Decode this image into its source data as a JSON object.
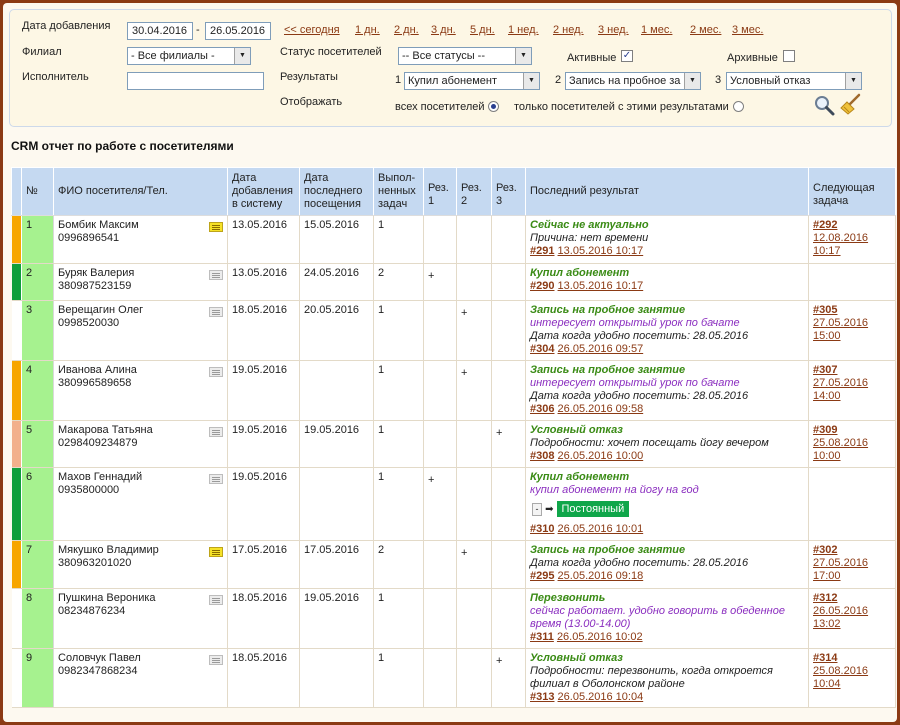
{
  "filters": {
    "date_label": "Дата добавления",
    "date_from": "30.04.2016",
    "dash": "-",
    "date_to": "26.05.2016",
    "quick_links": [
      "<< сегодня",
      "1 дн.",
      "2 дн.",
      "3 дн.",
      "5 дн.",
      "1 нед.",
      "2 нед.",
      "3 нед.",
      "1 мес.",
      "2 мес.",
      "3 мес."
    ],
    "branch_label": "Филиал",
    "branch_value": "- Все филиалы -",
    "status_label": "Статус посетителей",
    "status_value": "-- Все статусы --",
    "active_label": "Активные",
    "active_checked": true,
    "archive_label": "Архивные",
    "archive_checked": false,
    "executor_label": "Исполнитель",
    "executor_value": "",
    "results_label": "Результаты",
    "result1_num": "1",
    "result1_value": "Купил абонемент",
    "result2_num": "2",
    "result2_value": "Запись на пробное за",
    "result3_num": "3",
    "result3_value": "Условный отказ",
    "display_label": "Отображать",
    "display_all": "всех посетителей",
    "display_only": "только посетителей с этими результатами",
    "display_selected": "all"
  },
  "report": {
    "title": "CRM отчет по работе с посетителями",
    "headers": {
      "num": "№",
      "name": "ФИО посетителя/Тел.",
      "added": "Дата добавления в систему",
      "last_visit": "Дата последнего посещения",
      "done": "Выпол-ненных задач",
      "r1": "Рез. 1",
      "r2": "Рез. 2",
      "r3": "Рез. 3",
      "last_result": "Последний результат",
      "next_task": "Следующая задача"
    },
    "colors": {
      "orange": "#f7a600",
      "green": "#0f9e3c",
      "peach": "#f2b08c",
      "num_bg": "#a6f28f",
      "header_bg": "#c5d9f1"
    },
    "rows": [
      {
        "status": "orange",
        "num": "1",
        "name": "Бомбик Максим",
        "phone": "0996896541",
        "icon": "yellow",
        "added": "13.05.2016",
        "last_visit": "15.05.2016",
        "done": "1",
        "r1": "",
        "r2": "",
        "r3": "",
        "result": "Сейчас не актуально",
        "lines": [
          {
            "cls": "plain",
            "text": "Причина: нет времени"
          }
        ],
        "task_num": "#291",
        "task_date": "13.05.2016 10:17",
        "next_num": "#292",
        "next_date": "12.08.2016",
        "next_time": "10:17"
      },
      {
        "status": "green",
        "num": "2",
        "name": "Буряк Валерия",
        "phone": "380987523159",
        "icon": "grey",
        "added": "13.05.2016",
        "last_visit": "24.05.2016",
        "done": "2",
        "r1": "+",
        "r2": "",
        "r3": "",
        "result": "Купил абонемент",
        "lines": [],
        "task_num": "#290",
        "task_date": "13.05.2016 10:17",
        "next_num": "",
        "next_date": "",
        "next_time": ""
      },
      {
        "status": "none",
        "num": "3",
        "name": "Верещагин Олег",
        "phone": "0998520030",
        "icon": "grey",
        "added": "18.05.2016",
        "last_visit": "20.05.2016",
        "done": "1",
        "r1": "",
        "r2": "+",
        "r3": "",
        "result": "Запись на пробное занятие",
        "lines": [
          {
            "cls": "note",
            "text": "интересует открытый урок по бачате"
          },
          {
            "cls": "plain",
            "text": "Дата когда удобно посетить: 28.05.2016"
          }
        ],
        "task_num": "#304",
        "task_date": "26.05.2016 09:57",
        "next_num": "#305",
        "next_date": "27.05.2016",
        "next_time": "15:00"
      },
      {
        "status": "orange",
        "num": "4",
        "name": "Иванова Алина",
        "phone": "380996589658",
        "icon": "grey",
        "added": "19.05.2016",
        "last_visit": "",
        "done": "1",
        "r1": "",
        "r2": "+",
        "r3": "",
        "result": "Запись на пробное занятие",
        "lines": [
          {
            "cls": "note",
            "text": "интересует открытый урок по бачате"
          },
          {
            "cls": "plain",
            "text": "Дата когда удобно посетить: 28.05.2016"
          }
        ],
        "task_num": "#306",
        "task_date": "26.05.2016 09:58",
        "next_num": "#307",
        "next_date": "27.05.2016",
        "next_time": "14:00"
      },
      {
        "status": "peach",
        "num": "5",
        "name": "Макарова Татьяна",
        "phone": "0298409234879",
        "icon": "grey",
        "added": "19.05.2016",
        "last_visit": "19.05.2016",
        "done": "1",
        "r1": "",
        "r2": "",
        "r3": "+",
        "result": "Условный отказ",
        "lines": [
          {
            "cls": "plain",
            "text": "Подробности: хочет посещать йогу вечером"
          }
        ],
        "task_num": "#308",
        "task_date": "26.05.2016 10:00",
        "next_num": "#309",
        "next_date": "25.08.2016",
        "next_time": "10:00"
      },
      {
        "status": "green",
        "num": "6",
        "name": "Махов Геннадий",
        "phone": "0935800000",
        "icon": "grey",
        "added": "19.05.2016",
        "last_visit": "",
        "done": "1",
        "r1": "+",
        "r2": "",
        "r3": "",
        "result": "Купил абонемент",
        "lines": [
          {
            "cls": "note",
            "text": "купил абонемент на йогу на год"
          }
        ],
        "tag": "Постоянный",
        "tag_minus": "-",
        "tag_arrow": "➡",
        "task_num": "#310",
        "task_date": "26.05.2016 10:01",
        "next_num": "",
        "next_date": "",
        "next_time": ""
      },
      {
        "status": "orange",
        "num": "7",
        "name": "Мякушко Владимир",
        "phone": "380963201020",
        "icon": "yellow",
        "added": "17.05.2016",
        "last_visit": "17.05.2016",
        "done": "2",
        "r1": "",
        "r2": "+",
        "r3": "",
        "result": "Запись на пробное занятие",
        "lines": [
          {
            "cls": "plain",
            "text": "Дата когда удобно посетить: 28.05.2016"
          }
        ],
        "task_num": "#295",
        "task_date": "25.05.2016 09:18",
        "next_num": "#302",
        "next_date": "27.05.2016",
        "next_time": "17:00"
      },
      {
        "status": "none",
        "num": "8",
        "name": "Пушкина Вероника",
        "phone": "08234876234",
        "icon": "grey",
        "added": "18.05.2016",
        "last_visit": "19.05.2016",
        "done": "1",
        "r1": "",
        "r2": "",
        "r3": "",
        "result": "Перезвонить",
        "lines": [
          {
            "cls": "note",
            "text": "сейчас работает. удобно говорить в обеденное время (13.00-14.00)"
          }
        ],
        "task_num": "#311",
        "task_date": "26.05.2016 10:02",
        "next_num": "#312",
        "next_date": "26.05.2016",
        "next_time": "13:02"
      },
      {
        "status": "none",
        "num": "9",
        "name": "Соловчук Павел",
        "phone": "0982347868234",
        "icon": "grey",
        "added": "18.05.2016",
        "last_visit": "",
        "done": "1",
        "r1": "",
        "r2": "",
        "r3": "+",
        "result": "Условный отказ",
        "lines": [
          {
            "cls": "plain",
            "text": "Подробности: перезвонить, когда откроется филиал в Оболонском районе"
          }
        ],
        "task_num": "#313",
        "task_date": "26.05.2016 10:04",
        "next_num": "#314",
        "next_date": "25.08.2016",
        "next_time": "10:04"
      }
    ]
  }
}
